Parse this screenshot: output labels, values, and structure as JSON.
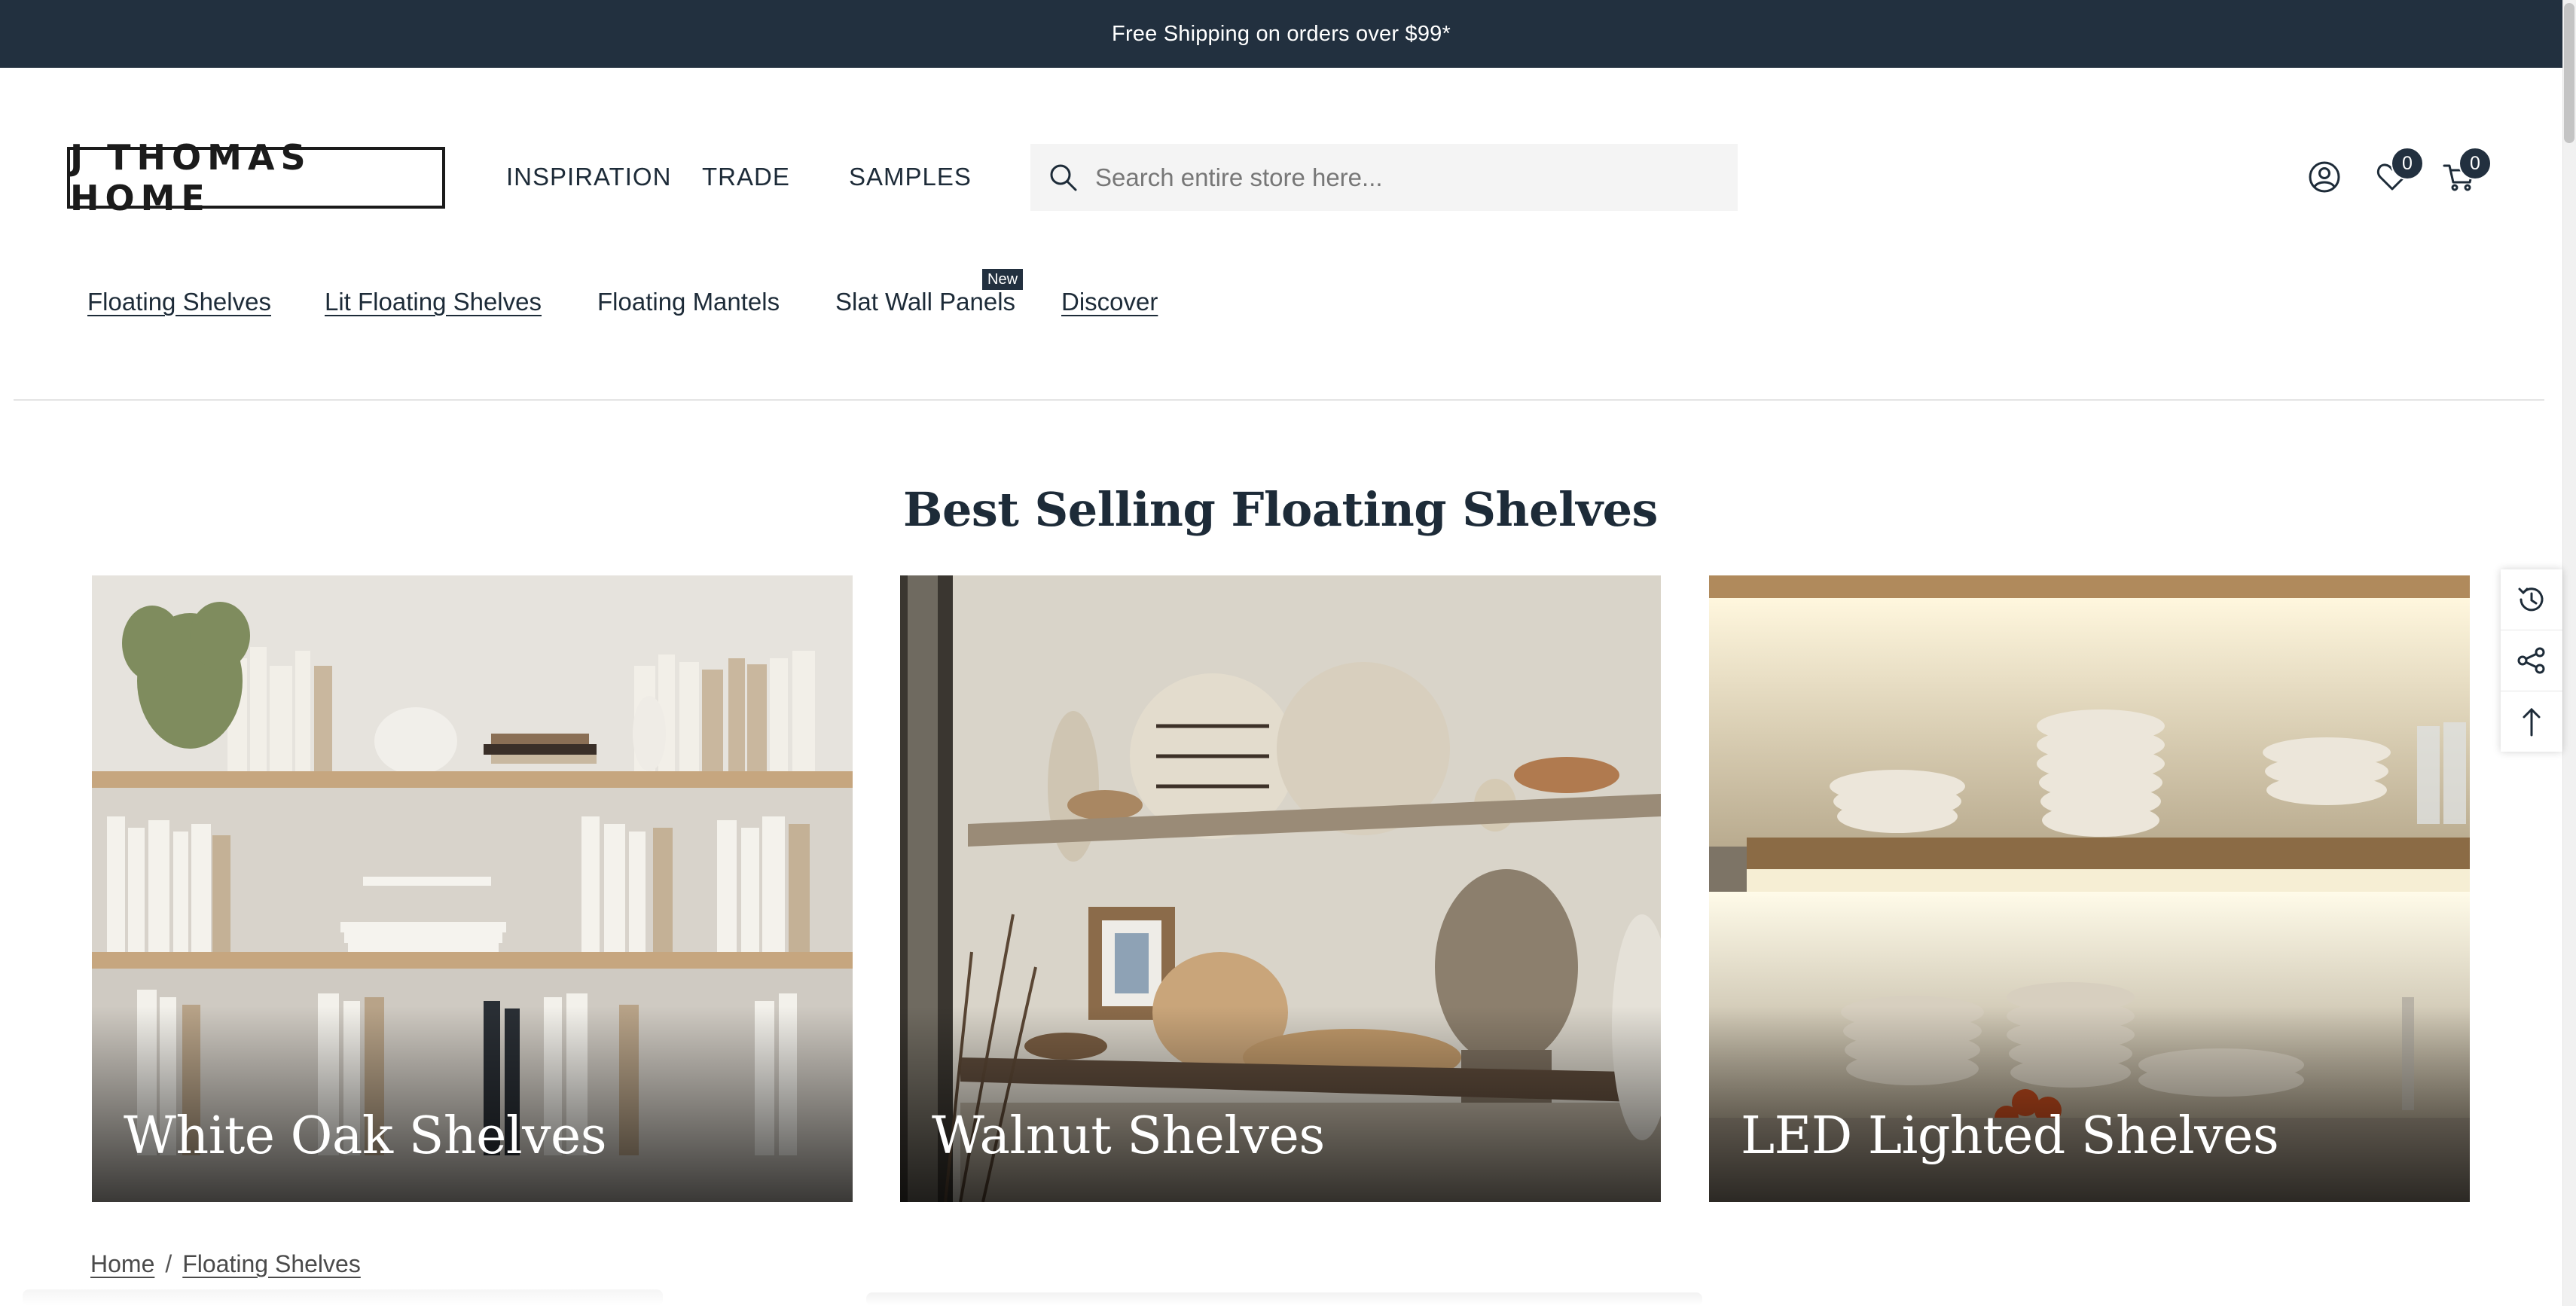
{
  "announcement": {
    "text": "Free Shipping on orders over $99*"
  },
  "header": {
    "logo_text": "J THOMAS HOME",
    "nav": [
      {
        "label": "INSPIRATION"
      },
      {
        "label": "TRADE"
      },
      {
        "label": "SAMPLES"
      }
    ],
    "search": {
      "placeholder": "Search entire store here..."
    },
    "icons": {
      "account": "user-circle-icon",
      "wishlist": "heart-icon",
      "cart": "cart-icon",
      "search": "search-icon"
    },
    "wishlist_count": "0",
    "cart_count": "0"
  },
  "category_nav": [
    {
      "label": "Floating Shelves",
      "underlined": true
    },
    {
      "label": "Lit Floating Shelves",
      "underlined": true
    },
    {
      "label": "Floating Mantels",
      "underlined": false
    },
    {
      "label": "Slat Wall Panels",
      "underlined": false,
      "badge": "New"
    },
    {
      "label": "Discover",
      "underlined": true
    }
  ],
  "section": {
    "title": "Best Selling Floating Shelves",
    "cards": [
      {
        "label": "White Oak Shelves",
        "image": "white-oak-shelves-photo"
      },
      {
        "label": "Walnut Shelves",
        "image": "walnut-shelves-photo"
      },
      {
        "label": "LED Lighted Shelves",
        "image": "led-lighted-shelves-photo"
      }
    ]
  },
  "side_tools": [
    {
      "icon": "history-icon"
    },
    {
      "icon": "share-icon"
    },
    {
      "icon": "arrow-up-icon"
    }
  ],
  "breadcrumb": [
    {
      "label": "Home"
    },
    {
      "label": "Floating Shelves"
    }
  ],
  "colors": {
    "dark_navy": "#22303f",
    "text": "#1d2b38",
    "search_bg": "#f4f4f4"
  }
}
